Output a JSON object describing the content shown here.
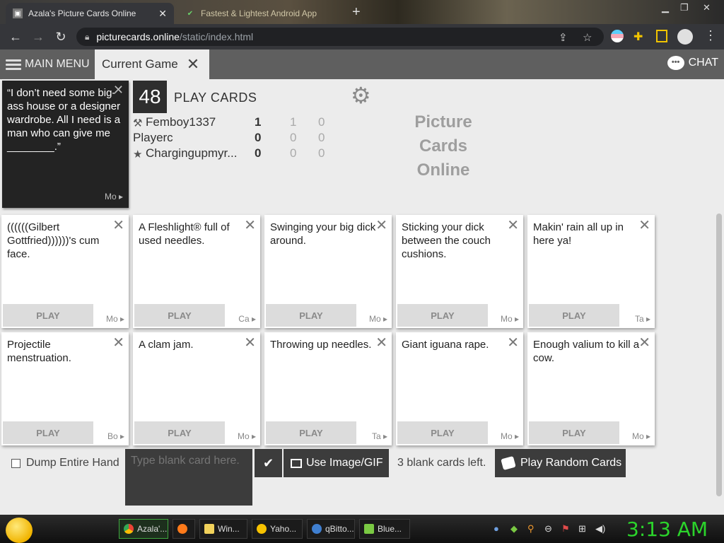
{
  "browser": {
    "tabs": [
      {
        "title": "Azala's Picture Cards Online",
        "active": true
      },
      {
        "title": "Fastest & Lightest Android App",
        "active": false
      }
    ],
    "url_host": "picturecards.online",
    "url_path": "/static/index.html"
  },
  "appbar": {
    "menu_label": "MAIN MENU",
    "game_tab_label": "Current Game",
    "chat_label": "CHAT"
  },
  "black_card": {
    "text": "“I don’t need some big-ass house or a designer wardrobe. All I need is a man who can give me ________.”",
    "owner": "Mo"
  },
  "game": {
    "card_count": "48",
    "play_cards_label": "PLAY CARDS",
    "logo_lines": [
      "Picture",
      "Cards",
      "Online"
    ]
  },
  "players": [
    {
      "icon": "gavel-icon",
      "name": "Femboy1337",
      "score": "1",
      "s2": "1",
      "s3": "0"
    },
    {
      "icon": "",
      "name": "Playerc",
      "score": "0",
      "s2": "0",
      "s3": "0"
    },
    {
      "icon": "star-icon",
      "name": "Chargingupmyr...",
      "score": "0",
      "s2": "0",
      "s3": "0"
    }
  ],
  "hand": [
    {
      "text": "((((((Gilbert Gottfried))))))'s cum face.",
      "owner": "Mo"
    },
    {
      "text": "A Fleshlight® full of used needles.",
      "owner": "Ca"
    },
    {
      "text": "Swinging your big dick around.",
      "owner": "Mo"
    },
    {
      "text": "Sticking your dick between the couch cushions.",
      "owner": "Mo"
    },
    {
      "text": "Makin' rain all up in here ya!",
      "owner": "Ta"
    },
    {
      "text": "Projectile menstruation.",
      "owner": "Bo"
    },
    {
      "text": "A clam jam.",
      "owner": "Mo"
    },
    {
      "text": "Throwing up needles.",
      "owner": "Ta"
    },
    {
      "text": "Giant iguana rape.",
      "owner": "Mo"
    },
    {
      "text": "Enough valium to kill a cow.",
      "owner": "Mo"
    }
  ],
  "play_label": "PLAY",
  "controls": {
    "dump_hand_label": "Dump Entire Hand",
    "blank_placeholder": "Type blank card here.",
    "use_image_label": "Use Image/GIF",
    "blanks_left": "3 blank cards left.",
    "play_random_label": "Play Random Cards"
  },
  "taskbar": {
    "tasks": [
      "Azala'...",
      "Win...",
      "Yaho...",
      "qBitto...",
      "Blue..."
    ],
    "clock": "3:13 AM"
  },
  "colors": {
    "black_card_bg": "#232323",
    "button_dark": "#3c3c3c",
    "appbar_bg": "#5f5f5f",
    "clock": "#2bd42b"
  }
}
